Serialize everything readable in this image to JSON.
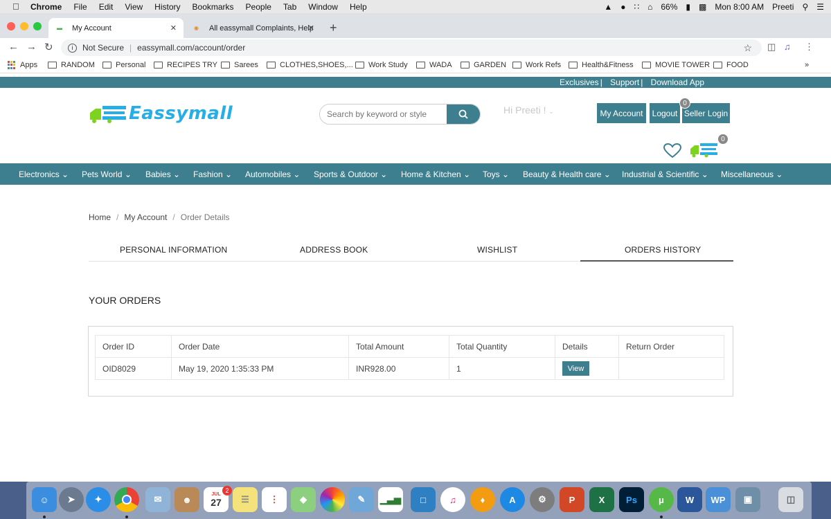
{
  "menubar": {
    "app": "Chrome",
    "items": [
      "File",
      "Edit",
      "View",
      "History",
      "Bookmarks",
      "People",
      "Tab",
      "Window",
      "Help"
    ],
    "battery": "66%",
    "clock": "Mon 8:00 AM",
    "user": "Preeti"
  },
  "browser": {
    "tabs": [
      {
        "title": "My Account",
        "active": true
      },
      {
        "title": "All eassymall Complaints, Help",
        "active": false
      }
    ],
    "security": "Not Secure",
    "url": "eassymall.com/account/order",
    "bookmarks": [
      "Apps",
      "RANDOM",
      "Personal",
      "RECIPES TRY",
      "Sarees",
      "CLOTHES,SHOES,...",
      "Work Study",
      "WADA",
      "GARDEN",
      "Work Refs",
      "Health&Fitness",
      "MOVIE TOWER",
      "FOOD"
    ]
  },
  "site": {
    "top_links": [
      "Exclusives",
      "Support",
      "Download App"
    ],
    "logo_text": "Eassymall",
    "search_placeholder": "Search by keyword or style",
    "greeting": "Hi Preeti !",
    "buttons": {
      "my_account": "My Account",
      "logout": "Logout",
      "seller_login": "Seller Login"
    },
    "badges": {
      "seller": "0",
      "cart": "0"
    },
    "categories": [
      "Electronics",
      "Pets World",
      "Babies",
      "Fashion",
      "Automobiles",
      "Sports & Outdoor",
      "Home & Kitchen",
      "Toys",
      "Beauty & Health care",
      "Industrial & Scientific",
      "Miscellaneous"
    ],
    "breadcrumb": [
      "Home",
      "My Account",
      "Order Details"
    ],
    "account_tabs": [
      "PERSONAL INFORMATION",
      "ADDRESS BOOK",
      "WISHLIST",
      "ORDERS HISTORY"
    ],
    "active_tab": "ORDERS HISTORY",
    "orders_heading": "YOUR ORDERS",
    "orders_table": {
      "headers": [
        "Order ID",
        "Order Date",
        "Total Amount",
        "Total Quantity",
        "Details",
        "Return Order"
      ],
      "rows": [
        {
          "order_id": "OID8029",
          "order_date": "May 19, 2020 1:35:33 PM",
          "total_amount": "INR928.00",
          "total_quantity": "1",
          "details": "View",
          "return_order": ""
        }
      ]
    },
    "colors": {
      "brand_teal": "#3d7f8e",
      "logo_blue": "#27aee6",
      "logo_green": "#7ed321"
    }
  },
  "dock": {
    "calendar_month": "JUL",
    "calendar_day": "27",
    "calendar_badge": "2",
    "apps": [
      "finder-icon",
      "launchpad-icon",
      "safari-icon",
      "chrome-icon",
      "mail-icon",
      "contacts-icon",
      "calendar-icon",
      "notes-icon",
      "reminders-icon",
      "maps-icon",
      "photos-icon",
      "preview-icon",
      "numbers-icon",
      "keynote-icon",
      "itunes-icon",
      "books-icon",
      "app-store-icon",
      "system-preferences-icon",
      "powerpoint-icon",
      "excel-icon",
      "photoshop-icon",
      "utorrent-icon",
      "word-icon",
      "wordperfect-icon",
      "image-capture-icon",
      "trash-icon"
    ]
  }
}
